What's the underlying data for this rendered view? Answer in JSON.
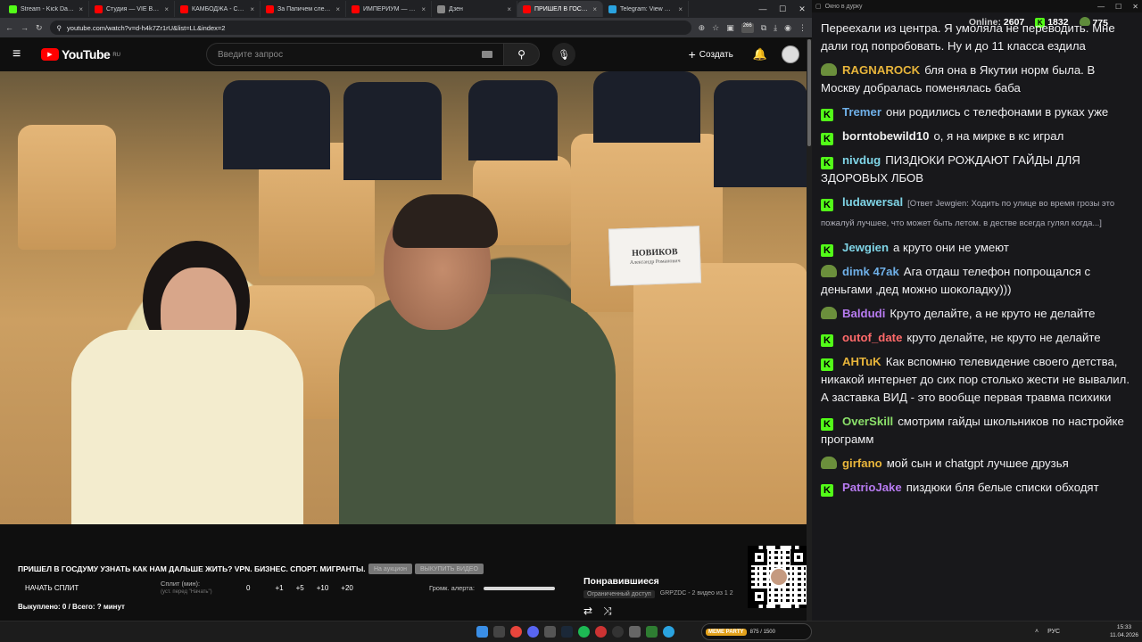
{
  "browser": {
    "tabs": [
      {
        "title": "Stream - Kick Dashboard",
        "color": "#53fc18",
        "active": false
      },
      {
        "title": "Студия — VIE Видео | Т",
        "color": "#ff0000",
        "active": false
      },
      {
        "title": "КАМБОДЖА - Столица",
        "color": "#ff0000",
        "active": false
      },
      {
        "title": "За Папичем следят в р",
        "color": "#ff0000",
        "active": false
      },
      {
        "title": "ИМПЕРИУМ — НЕ РО",
        "color": "#ff0000",
        "active": false
      },
      {
        "title": "Дзен",
        "color": "#888888",
        "active": false
      },
      {
        "title": "ПРИШЕЛ В ГОСДУ",
        "color": "#ff0000",
        "active": true
      },
      {
        "title": "Telegram: View @dvach",
        "color": "#2aa3e0",
        "active": false
      }
    ],
    "url": "youtube.com/watch?v=d-h4k7Zr1rU&list=LL&index=2",
    "tab_count_badge": "266"
  },
  "youtube": {
    "logo": "YouTube",
    "region": "RU",
    "search_placeholder": "Введите запрос",
    "create_label": "Создать"
  },
  "video": {
    "namecard_name": "НОВИКОВ",
    "namecard_sub": "Александр Романович"
  },
  "extension": {
    "title": "ПРИШЕЛ В ГОСДУМУ УЗНАТЬ КАК НАМ ДАЛЬШЕ ЖИТЬ? VPN. БИЗНЕС. СПОРТ. МИГРАНТЫ.",
    "chip1": "На аукцион",
    "chip2": "ВЫКУПИТЬ ВИДЕО",
    "start_split": "НАЧАТЬ СПЛИТ",
    "split_label": "Сплит (мин):",
    "split_hint": "(уст. перед \"Начать\")",
    "split_values": [
      "0",
      "+1",
      "+5",
      "+10",
      "+20"
    ],
    "volume_label": "Громк. алерта:",
    "summary": "Выкуплено: 0 / Всего: ? минут"
  },
  "playlist": {
    "title": "Понравившиеся",
    "access": "Ограниченный доступ",
    "meta": "GRPZDC - 2 видео из 1 2"
  },
  "taskbar": {
    "memeparty_label": "MEME PARTY",
    "memeparty_count": "875 / 1500",
    "lang": "РУС",
    "time": "15:33",
    "date": "11.04.2026"
  },
  "chat": {
    "window_title": "Окно в дурку",
    "online_label": "Online:",
    "online_count": "2607",
    "kick_count": "1832",
    "frog_count": "775",
    "messages": [
      {
        "user": "",
        "user_color": "#ffffff",
        "badge": "none",
        "text": "Переехали из центра. Я умоляла не переводить. Мне дали год попробовать. Ну и до 11 класса ездила"
      },
      {
        "user": "RAGNAROCK",
        "user_color": "#e8b53b",
        "badge": "frog",
        "text": "бля она в Якутии норм была. В Москву добралась поменялась баба"
      },
      {
        "user": "Tremer",
        "user_color": "#6fb0e8",
        "badge": "kick",
        "text": "они родились с телефонами в руках уже"
      },
      {
        "user": "borntobewild10",
        "user_color": "#f0f0f0",
        "badge": "kick",
        "text": "о, я на мирке в кс играл"
      },
      {
        "user": "nivdug",
        "user_color": "#7fd4e6",
        "badge": "kick",
        "text": "ПИЗДЮКИ РОЖДАЮТ ГАЙДЫ ДЛЯ ЗДОРОВЫХ ЛБОВ"
      },
      {
        "user": "ludawersal",
        "user_color": "#7fd4e6",
        "badge": "kick",
        "text": "[Ответ Jewgien: Ходить по улице во время грозы это пожалуй лучшее, что может быть летом. в дестве всегда гулял когда...]"
      },
      {
        "user": "Jewgien",
        "user_color": "#7fd4e6",
        "badge": "kick",
        "text": "а круто они не умеют"
      },
      {
        "user": "dimk 47ak",
        "user_color": "#6fb0e8",
        "badge": "frog",
        "text": "Ага отдаш телефон попрощался с деньгами ,дед можно шоколадку)))"
      },
      {
        "user": "Baldudi",
        "user_color": "#b77bf0",
        "badge": "frog",
        "text": "Круто делайте, а не круто не делайте"
      },
      {
        "user": "outof_date",
        "user_color": "#ff6a6a",
        "badge": "kick",
        "text": "круто делайте, не круто не делайте"
      },
      {
        "user": "AHTuK",
        "user_color": "#e8b53b",
        "badge": "kick",
        "text": "Как вспомню телевидение своего детства, никакой интернет до сих пор столько жести не вывалил. А заставка ВИД - это вообще первая травма психики"
      },
      {
        "user": "OverSkill",
        "user_color": "#8be06a",
        "badge": "kick",
        "text": "смотрим гайды школьников по настройке программ"
      },
      {
        "user": "girfano",
        "user_color": "#e8b53b",
        "badge": "frog",
        "text": "мой сын и chatgpt  лучшее друзья"
      },
      {
        "user": "PatrioJake",
        "user_color": "#b77bf0",
        "badge": "kick",
        "text": "пиздюки бля белые списки обходят"
      }
    ]
  }
}
